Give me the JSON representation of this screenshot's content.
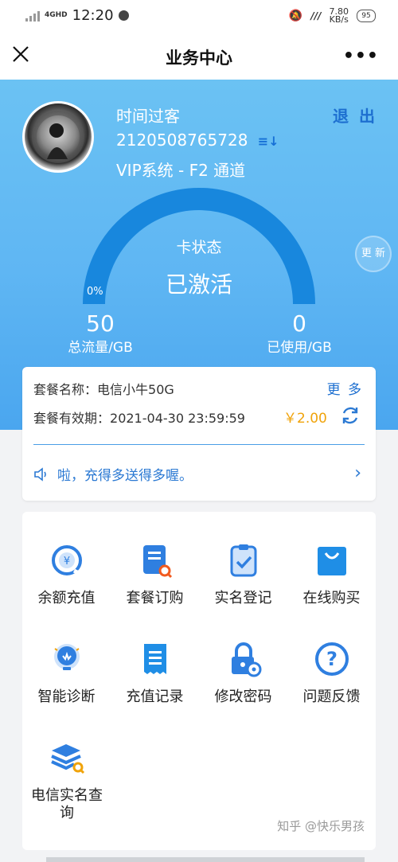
{
  "status_bar": {
    "network": "4GHD",
    "time": "12:20",
    "speed_value": "7.80",
    "speed_unit": "KB/s",
    "battery": "95"
  },
  "header": {
    "title": "业务中心",
    "more": "•••"
  },
  "profile": {
    "name": "时间过客",
    "phone": "2120508765728",
    "system_line": "VIP系统 - F2 通道",
    "logout": "退 出"
  },
  "gauge": {
    "status_label": "卡状态",
    "status_value": "已激活",
    "percent_label": "0%",
    "percent": 0,
    "refresh_label": "更 新"
  },
  "stats": {
    "total_value": "50",
    "total_label": "总流量/GB",
    "used_value": "0",
    "used_label": "已使用/GB"
  },
  "plan": {
    "name_label": "套餐名称：",
    "name_value": "电信小牛50G",
    "more": "更 多",
    "expiry_label": "套餐有效期：",
    "expiry_value": "2021-04-30 23:59:59",
    "price": "￥2.00",
    "notice": "啦，充得多送得多喔。"
  },
  "services": [
    {
      "label": "余额充值",
      "icon": "yuan-refresh-icon"
    },
    {
      "label": "套餐订购",
      "icon": "clipboard-search-icon"
    },
    {
      "label": "实名登记",
      "icon": "clipboard-check-icon"
    },
    {
      "label": "在线购买",
      "icon": "shopping-bag-icon"
    },
    {
      "label": "智能诊断",
      "icon": "lightbulb-icon"
    },
    {
      "label": "充值记录",
      "icon": "receipt-icon"
    },
    {
      "label": "修改密码",
      "icon": "lock-gear-icon"
    },
    {
      "label": "问题反馈",
      "icon": "question-icon"
    },
    {
      "label": "电信实名查询",
      "icon": "layers-search-icon"
    }
  ],
  "watermark": "知乎 @快乐男孩",
  "colors": {
    "brand_blue": "#1d6fd0",
    "hero_top": "#6bc2f3",
    "gauge_arc": "#1887dd",
    "price_orange": "#f0a30a"
  }
}
